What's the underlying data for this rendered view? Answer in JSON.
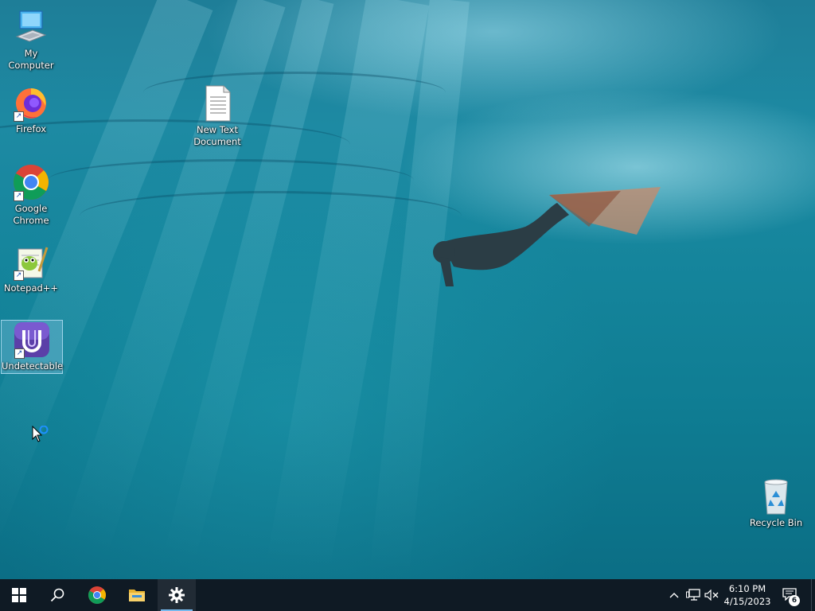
{
  "desktop": {
    "icons": [
      {
        "label": "My Computer"
      },
      {
        "label": "Firefox"
      },
      {
        "label": "Google Chrome"
      },
      {
        "label": "Notepad++"
      },
      {
        "label": "Undetectable"
      },
      {
        "label": "New Text Document"
      },
      {
        "label": "Recycle Bin"
      }
    ],
    "selected_icon": "Undetectable"
  },
  "taskbar": {
    "buttons": [
      {
        "icon": "windows-start-icon"
      },
      {
        "icon": "search-icon"
      },
      {
        "icon": "chrome-icon"
      },
      {
        "icon": "file-explorer-icon"
      },
      {
        "icon": "settings-gear-icon",
        "active": true
      }
    ],
    "tray": {
      "icons": [
        "chevron-up-icon",
        "network-icon",
        "volume-muted-icon"
      ],
      "time": "6:10 PM",
      "date": "4/15/2023",
      "notification_count": "6"
    }
  },
  "colors": {
    "taskbar_bg": "#0f1a24",
    "accent": "#76b9ed"
  }
}
